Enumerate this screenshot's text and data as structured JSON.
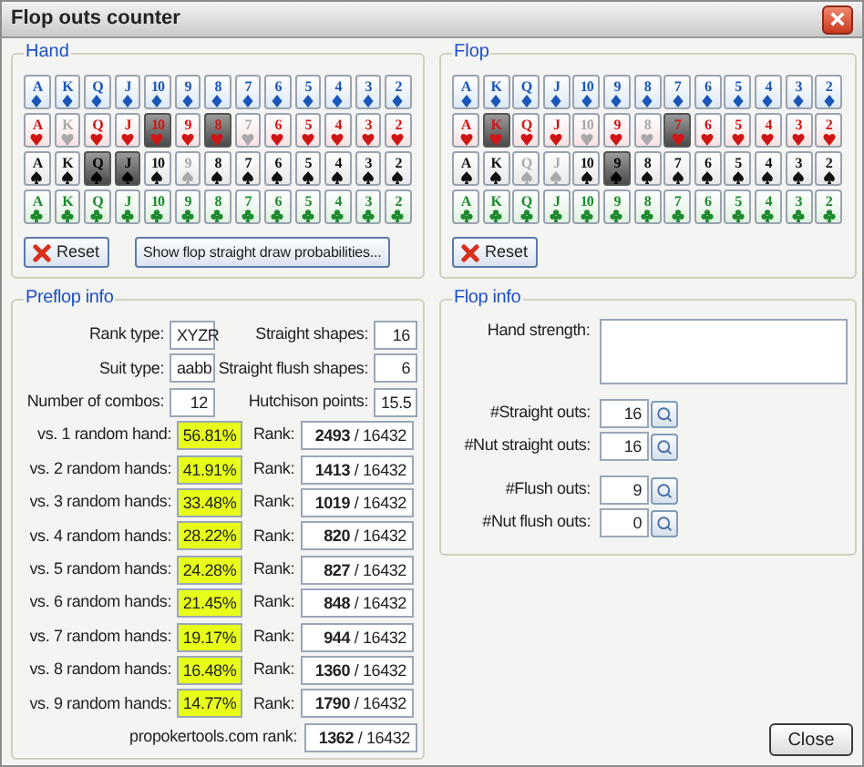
{
  "window": {
    "title": "Flop outs counter"
  },
  "hand": {
    "title": "Hand",
    "rows": [
      {
        "kind": "diamonds",
        "cards": [
          {
            "rank": "A",
            "selected": false,
            "disabled": false
          },
          {
            "rank": "K",
            "selected": false,
            "disabled": false
          },
          {
            "rank": "Q",
            "selected": false,
            "disabled": false
          },
          {
            "rank": "J",
            "selected": false,
            "disabled": false
          },
          {
            "rank": "10",
            "selected": false,
            "disabled": false
          },
          {
            "rank": "9",
            "selected": false,
            "disabled": false
          },
          {
            "rank": "8",
            "selected": false,
            "disabled": false
          },
          {
            "rank": "7",
            "selected": false,
            "disabled": false
          },
          {
            "rank": "6",
            "selected": false,
            "disabled": false
          },
          {
            "rank": "5",
            "selected": false,
            "disabled": false
          },
          {
            "rank": "4",
            "selected": false,
            "disabled": false
          },
          {
            "rank": "3",
            "selected": false,
            "disabled": false
          },
          {
            "rank": "2",
            "selected": false,
            "disabled": false
          }
        ]
      },
      {
        "kind": "hearts",
        "cards": [
          {
            "rank": "A",
            "selected": false,
            "disabled": false
          },
          {
            "rank": "K",
            "selected": false,
            "disabled": true
          },
          {
            "rank": "Q",
            "selected": false,
            "disabled": false
          },
          {
            "rank": "J",
            "selected": false,
            "disabled": false
          },
          {
            "rank": "10",
            "selected": true,
            "disabled": false
          },
          {
            "rank": "9",
            "selected": false,
            "disabled": false
          },
          {
            "rank": "8",
            "selected": true,
            "disabled": false
          },
          {
            "rank": "7",
            "selected": false,
            "disabled": true
          },
          {
            "rank": "6",
            "selected": false,
            "disabled": false
          },
          {
            "rank": "5",
            "selected": false,
            "disabled": false
          },
          {
            "rank": "4",
            "selected": false,
            "disabled": false
          },
          {
            "rank": "3",
            "selected": false,
            "disabled": false
          },
          {
            "rank": "2",
            "selected": false,
            "disabled": false
          }
        ]
      },
      {
        "kind": "spades",
        "cards": [
          {
            "rank": "A",
            "selected": false,
            "disabled": false
          },
          {
            "rank": "K",
            "selected": false,
            "disabled": false
          },
          {
            "rank": "Q",
            "selected": true,
            "disabled": false
          },
          {
            "rank": "J",
            "selected": true,
            "disabled": false
          },
          {
            "rank": "10",
            "selected": false,
            "disabled": false
          },
          {
            "rank": "9",
            "selected": false,
            "disabled": true
          },
          {
            "rank": "8",
            "selected": false,
            "disabled": false
          },
          {
            "rank": "7",
            "selected": false,
            "disabled": false
          },
          {
            "rank": "6",
            "selected": false,
            "disabled": false
          },
          {
            "rank": "5",
            "selected": false,
            "disabled": false
          },
          {
            "rank": "4",
            "selected": false,
            "disabled": false
          },
          {
            "rank": "3",
            "selected": false,
            "disabled": false
          },
          {
            "rank": "2",
            "selected": false,
            "disabled": false
          }
        ]
      },
      {
        "kind": "clubs",
        "cards": [
          {
            "rank": "A",
            "selected": false,
            "disabled": false
          },
          {
            "rank": "K",
            "selected": false,
            "disabled": false
          },
          {
            "rank": "Q",
            "selected": false,
            "disabled": false
          },
          {
            "rank": "J",
            "selected": false,
            "disabled": false
          },
          {
            "rank": "10",
            "selected": false,
            "disabled": false
          },
          {
            "rank": "9",
            "selected": false,
            "disabled": false
          },
          {
            "rank": "8",
            "selected": false,
            "disabled": false
          },
          {
            "rank": "7",
            "selected": false,
            "disabled": false
          },
          {
            "rank": "6",
            "selected": false,
            "disabled": false
          },
          {
            "rank": "5",
            "selected": false,
            "disabled": false
          },
          {
            "rank": "4",
            "selected": false,
            "disabled": false
          },
          {
            "rank": "3",
            "selected": false,
            "disabled": false
          },
          {
            "rank": "2",
            "selected": false,
            "disabled": false
          }
        ]
      }
    ],
    "buttons": [
      {
        "label": "Reset",
        "kind": "reset"
      },
      {
        "label": "Show flop straight draw probabilities...",
        "kind": "plain"
      }
    ]
  },
  "flop": {
    "title": "Flop",
    "rows": [
      {
        "kind": "diamonds",
        "cards": [
          {
            "rank": "A",
            "selected": false,
            "disabled": false
          },
          {
            "rank": "K",
            "selected": false,
            "disabled": false
          },
          {
            "rank": "Q",
            "selected": false,
            "disabled": false
          },
          {
            "rank": "J",
            "selected": false,
            "disabled": false
          },
          {
            "rank": "10",
            "selected": false,
            "disabled": false
          },
          {
            "rank": "9",
            "selected": false,
            "disabled": false
          },
          {
            "rank": "8",
            "selected": false,
            "disabled": false
          },
          {
            "rank": "7",
            "selected": false,
            "disabled": false
          },
          {
            "rank": "6",
            "selected": false,
            "disabled": false
          },
          {
            "rank": "5",
            "selected": false,
            "disabled": false
          },
          {
            "rank": "4",
            "selected": false,
            "disabled": false
          },
          {
            "rank": "3",
            "selected": false,
            "disabled": false
          },
          {
            "rank": "2",
            "selected": false,
            "disabled": false
          }
        ]
      },
      {
        "kind": "hearts",
        "cards": [
          {
            "rank": "A",
            "selected": false,
            "disabled": false
          },
          {
            "rank": "K",
            "selected": true,
            "disabled": false
          },
          {
            "rank": "Q",
            "selected": false,
            "disabled": false
          },
          {
            "rank": "J",
            "selected": false,
            "disabled": false
          },
          {
            "rank": "10",
            "selected": false,
            "disabled": true
          },
          {
            "rank": "9",
            "selected": false,
            "disabled": false
          },
          {
            "rank": "8",
            "selected": false,
            "disabled": true
          },
          {
            "rank": "7",
            "selected": true,
            "disabled": false
          },
          {
            "rank": "6",
            "selected": false,
            "disabled": false
          },
          {
            "rank": "5",
            "selected": false,
            "disabled": false
          },
          {
            "rank": "4",
            "selected": false,
            "disabled": false
          },
          {
            "rank": "3",
            "selected": false,
            "disabled": false
          },
          {
            "rank": "2",
            "selected": false,
            "disabled": false
          }
        ]
      },
      {
        "kind": "spades",
        "cards": [
          {
            "rank": "A",
            "selected": false,
            "disabled": false
          },
          {
            "rank": "K",
            "selected": false,
            "disabled": false
          },
          {
            "rank": "Q",
            "selected": false,
            "disabled": true
          },
          {
            "rank": "J",
            "selected": false,
            "disabled": true
          },
          {
            "rank": "10",
            "selected": false,
            "disabled": false
          },
          {
            "rank": "9",
            "selected": true,
            "disabled": false
          },
          {
            "rank": "8",
            "selected": false,
            "disabled": false
          },
          {
            "rank": "7",
            "selected": false,
            "disabled": false
          },
          {
            "rank": "6",
            "selected": false,
            "disabled": false
          },
          {
            "rank": "5",
            "selected": false,
            "disabled": false
          },
          {
            "rank": "4",
            "selected": false,
            "disabled": false
          },
          {
            "rank": "3",
            "selected": false,
            "disabled": false
          },
          {
            "rank": "2",
            "selected": false,
            "disabled": false
          }
        ]
      },
      {
        "kind": "clubs",
        "cards": [
          {
            "rank": "A",
            "selected": false,
            "disabled": false
          },
          {
            "rank": "K",
            "selected": false,
            "disabled": false
          },
          {
            "rank": "Q",
            "selected": false,
            "disabled": false
          },
          {
            "rank": "J",
            "selected": false,
            "disabled": false
          },
          {
            "rank": "10",
            "selected": false,
            "disabled": false
          },
          {
            "rank": "9",
            "selected": false,
            "disabled": false
          },
          {
            "rank": "8",
            "selected": false,
            "disabled": false
          },
          {
            "rank": "7",
            "selected": false,
            "disabled": false
          },
          {
            "rank": "6",
            "selected": false,
            "disabled": false
          },
          {
            "rank": "5",
            "selected": false,
            "disabled": false
          },
          {
            "rank": "4",
            "selected": false,
            "disabled": false
          },
          {
            "rank": "3",
            "selected": false,
            "disabled": false
          },
          {
            "rank": "2",
            "selected": false,
            "disabled": false
          }
        ]
      }
    ],
    "buttons": [
      {
        "label": "Reset",
        "kind": "reset"
      }
    ]
  },
  "preflop_info": {
    "title": "Preflop info",
    "pairs": [
      [
        {
          "label": "Rank type:",
          "value": "XYZR"
        },
        {
          "label": "Straight shapes:",
          "value": "16"
        }
      ],
      [
        {
          "label": "Suit type:",
          "value": "aabb"
        },
        {
          "label": "Straight flush shapes:",
          "value": "6"
        }
      ],
      [
        {
          "label": "Number of combos:",
          "value": "12"
        },
        {
          "label": "Hutchison points:",
          "value": "15.5"
        }
      ]
    ],
    "equity_rows": [
      {
        "label": "vs. 1 random hand:",
        "equity": "56.81%",
        "rank_label": "Rank:",
        "rank": "2493",
        "total": "/ 16432"
      },
      {
        "label": "vs. 2 random hands:",
        "equity": "41.91%",
        "rank_label": "Rank:",
        "rank": "1413",
        "total": "/ 16432"
      },
      {
        "label": "vs. 3 random hands:",
        "equity": "33.48%",
        "rank_label": "Rank:",
        "rank": "1019",
        "total": "/ 16432"
      },
      {
        "label": "vs. 4 random hands:",
        "equity": "28.22%",
        "rank_label": "Rank:",
        "rank": "820",
        "total": "/ 16432"
      },
      {
        "label": "vs. 5 random hands:",
        "equity": "24.28%",
        "rank_label": "Rank:",
        "rank": "827",
        "total": "/ 16432"
      },
      {
        "label": "vs. 6 random hands:",
        "equity": "21.45%",
        "rank_label": "Rank:",
        "rank": "848",
        "total": "/ 16432"
      },
      {
        "label": "vs. 7 random hands:",
        "equity": "19.17%",
        "rank_label": "Rank:",
        "rank": "944",
        "total": "/ 16432"
      },
      {
        "label": "vs. 8 random hands:",
        "equity": "16.48%",
        "rank_label": "Rank:",
        "rank": "1360",
        "total": "/ 16432"
      },
      {
        "label": "vs. 9 random hands:",
        "equity": "14.77%",
        "rank_label": "Rank:",
        "rank": "1790",
        "total": "/ 16432"
      }
    ],
    "overall": {
      "label": "propokertools.com rank:",
      "rank": "1362",
      "total": "/ 16432"
    }
  },
  "flop_info": {
    "title": "Flop info",
    "hand_strength": {
      "label": "Hand strength:"
    },
    "out_groups": [
      [
        {
          "label": "#Straight outs:",
          "value": "16"
        },
        {
          "label": "#Nut straight outs:",
          "value": "16"
        }
      ],
      [
        {
          "label": "#Flush outs:",
          "value": "9"
        },
        {
          "label": "#Nut flush outs:",
          "value": "0"
        }
      ]
    ]
  },
  "close_button": "Close"
}
